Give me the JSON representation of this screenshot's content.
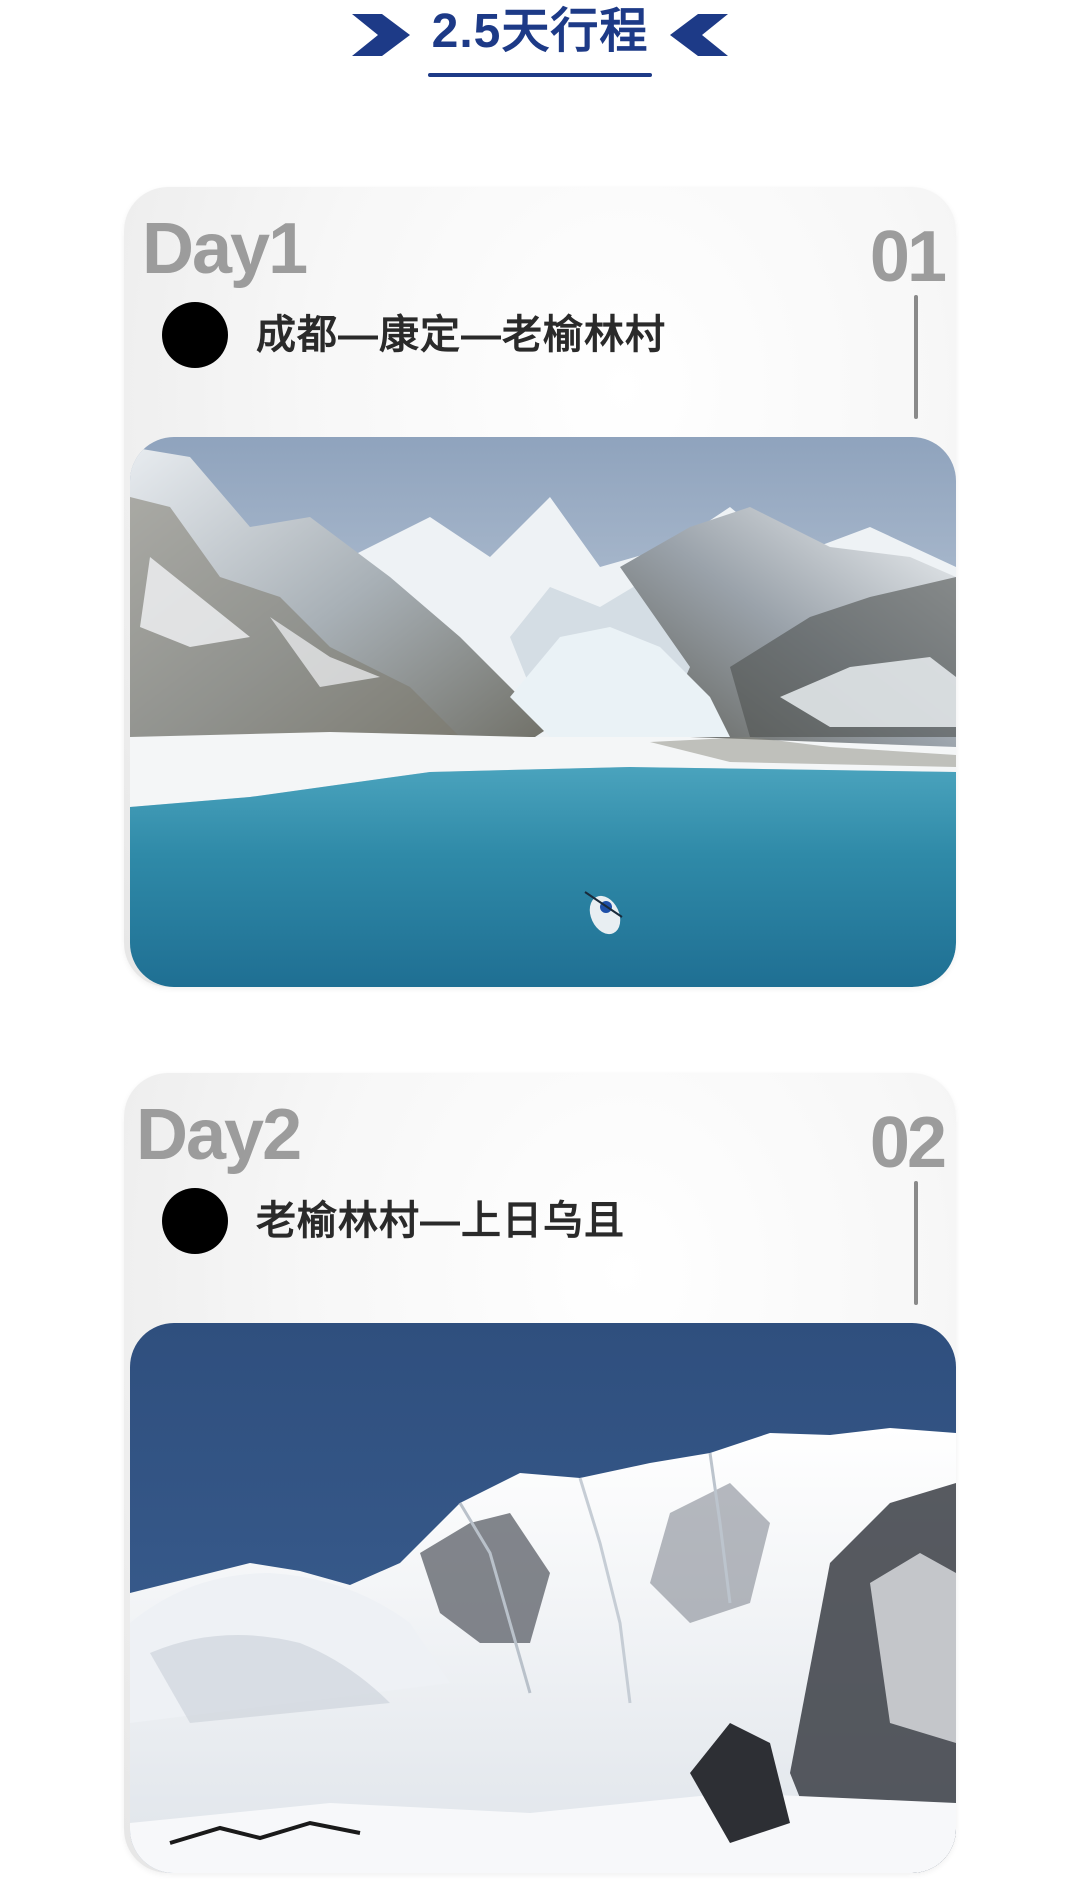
{
  "header": {
    "title": "2.5天行程",
    "left_icon": "chevron-right-icon",
    "right_icon": "chevron-left-icon",
    "color": "#1d3a87"
  },
  "days": [
    {
      "day": "Day1",
      "number": "01",
      "route": "成都—康定—老榆林村",
      "photo": "glacier-lake-kayak-photo"
    },
    {
      "day": "Day2",
      "number": "02",
      "route": "老榆林村—上日乌且",
      "photo": "snow-mountain-photo"
    }
  ]
}
